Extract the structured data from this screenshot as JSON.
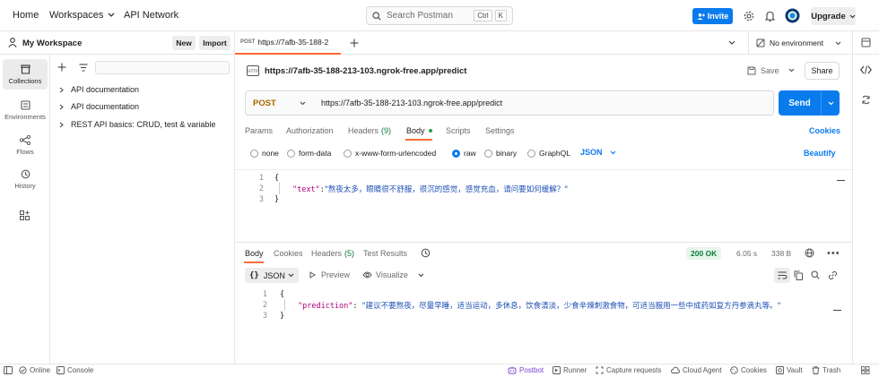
{
  "topbar": {
    "home": "Home",
    "workspaces": "Workspaces",
    "api_network": "API Network",
    "search_placeholder": "Search Postman",
    "shortcut_ctrl": "Ctrl",
    "shortcut_key": "K",
    "invite": "Invite",
    "upgrade": "Upgrade"
  },
  "workspace": {
    "name": "My Workspace",
    "new_label": "New",
    "import_label": "Import"
  },
  "rail": [
    {
      "label": "Collections",
      "icon": "collections-icon"
    },
    {
      "label": "Environments",
      "icon": "environments-icon"
    },
    {
      "label": "Flows",
      "icon": "flows-icon"
    },
    {
      "label": "History",
      "icon": "history-icon"
    }
  ],
  "collections": [
    "API documentation",
    "API documentation",
    "REST API basics: CRUD, test & variable"
  ],
  "tab": {
    "method": "POST",
    "title": "https://7afb-35-188-2"
  },
  "environment": "No environment",
  "request": {
    "title": "https://7afb-35-188-213-103.ngrok-free.app/predict",
    "save": "Save",
    "share": "Share",
    "method": "POST",
    "url": "https://7afb-35-188-213-103.ngrok-free.app/predict",
    "send": "Send",
    "tabs": {
      "params": "Params",
      "authorization": "Authorization",
      "headers": "Headers",
      "headers_count": "(9)",
      "body": "Body",
      "scripts": "Scripts",
      "settings": "Settings",
      "cookies": "Cookies"
    },
    "body_options": [
      "none",
      "form-data",
      "x-www-form-urlencoded",
      "raw",
      "binary",
      "GraphQL"
    ],
    "body_format": "JSON",
    "beautify": "Beautify",
    "lines": [
      "1",
      "2",
      "3"
    ],
    "code": {
      "open": "{",
      "key": "\"text\"",
      "colon": ":",
      "value": "\"熬夜太多，眼睛很不舒服，很沉的感觉，感觉充血，请问要如何缓解？\"",
      "close": "}"
    }
  },
  "response": {
    "tabs": {
      "body": "Body",
      "cookies": "Cookies",
      "headers": "Headers",
      "headers_count": "(5)",
      "test_results": "Test Results"
    },
    "status": "200 OK",
    "time": "6.05 s",
    "size": "338 B",
    "format": "JSON",
    "preview": "Preview",
    "visualize": "Visualize",
    "lines": [
      "1",
      "2",
      "3"
    ],
    "code": {
      "open": "{",
      "key": "\"prediction\"",
      "colon": ": ",
      "value": "\"建议不要熬夜，尽量早睡，适当运动，多休息，饮食清淡，少食辛辣刺激食物，可适当服用一些中成药如复方丹参滴丸等。\"",
      "close": "}"
    }
  },
  "footer": {
    "online": "Online",
    "console": "Console",
    "postbot": "Postbot",
    "runner": "Runner",
    "capture": "Capture requests",
    "cloud_agent": "Cloud Agent",
    "cookies": "Cookies",
    "vault": "Vault",
    "trash": "Trash"
  },
  "colors": {
    "accent": "#097bed",
    "method_post": "#a96400",
    "status_ok": "#0a7d3a",
    "active_tab": "#ff6c37",
    "json_key": "#b1007a",
    "json_string": "#1c4fb3",
    "postbot": "#7b3fd1"
  }
}
